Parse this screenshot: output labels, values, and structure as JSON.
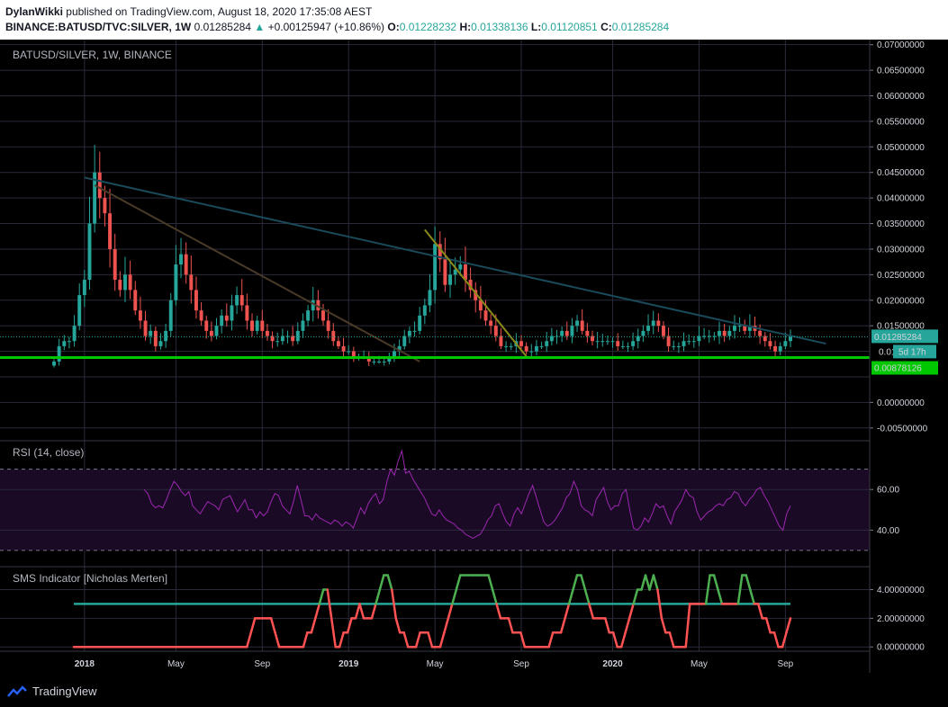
{
  "header": {
    "author": "DylanWikki",
    "published": "published on TradingView.com, August 18, 2020 17:35:08 AEST",
    "symbol": "BINANCE:BATUSD/TVC:SILVER, 1W",
    "last": "0.01285284",
    "change": "+0.00125947 (+10.86%)",
    "o_label": "O:",
    "o": "0.01228232",
    "h_label": "H:",
    "h": "0.01338136",
    "l_label": "L:",
    "l": "0.01120851",
    "c_label": "C:",
    "c": "0.01285284"
  },
  "footer": {
    "brand": "TradingView"
  },
  "colors": {
    "up": "#26a69a",
    "down": "#ef5350",
    "grid": "#2a2a3a",
    "rsi": "#9c27b0",
    "sms_high": "#4caf50",
    "sms_low": "#ff5252",
    "support": "#00c800",
    "trend_long": "#1a4a5a",
    "trend_mid": "#4a3a28",
    "trend_short": "#8a8a1a"
  },
  "chart_data": [
    {
      "type": "candlestick",
      "pane_label": "BATUSD/SILVER, 1W, BINANCE",
      "x_ticks": [
        "2018",
        "May",
        "Sep",
        "2019",
        "May",
        "Sep",
        "2020",
        "May",
        "Sep"
      ],
      "x_tick_weeks": [
        6,
        24,
        41,
        58,
        75,
        92,
        110,
        127,
        144
      ],
      "y_ticks": [
        "0.07000000",
        "0.06500000",
        "0.06000000",
        "0.05500000",
        "0.05000000",
        "0.04500000",
        "0.04000000",
        "0.03500000",
        "0.03000000",
        "0.02500000",
        "0.02000000",
        "0.01500000",
        "0.00000000",
        "-0.00500000"
      ],
      "ylim": [
        -0.0075,
        0.071
      ],
      "last_price_label": "0.01285284",
      "countdown_label": "5d 17h",
      "partial_label": "0.01",
      "support_price": 0.00878126,
      "support_label": "0.00878126",
      "series_closes": [
        0.008,
        0.011,
        0.012,
        0.012,
        0.015,
        0.021,
        0.024,
        0.035,
        0.045,
        0.04,
        0.037,
        0.03,
        0.024,
        0.022,
        0.025,
        0.022,
        0.018,
        0.016,
        0.013,
        0.014,
        0.011,
        0.012,
        0.014,
        0.02,
        0.027,
        0.029,
        0.025,
        0.022,
        0.018,
        0.016,
        0.014,
        0.013,
        0.015,
        0.017,
        0.016,
        0.019,
        0.021,
        0.019,
        0.016,
        0.014,
        0.016,
        0.014,
        0.013,
        0.012,
        0.012,
        0.013,
        0.013,
        0.012,
        0.014,
        0.016,
        0.018,
        0.02,
        0.018,
        0.016,
        0.014,
        0.012,
        0.011,
        0.01,
        0.01,
        0.009,
        0.009,
        0.009,
        0.008,
        0.008,
        0.008,
        0.008,
        0.009,
        0.01,
        0.011,
        0.013,
        0.014,
        0.014,
        0.017,
        0.019,
        0.022,
        0.031,
        0.028,
        0.023,
        0.025,
        0.026,
        0.027,
        0.024,
        0.022,
        0.02,
        0.018,
        0.016,
        0.015,
        0.013,
        0.011,
        0.011,
        0.011,
        0.012,
        0.011,
        0.01,
        0.01,
        0.011,
        0.011,
        0.012,
        0.013,
        0.013,
        0.014,
        0.013,
        0.015,
        0.016,
        0.014,
        0.013,
        0.012,
        0.012,
        0.012,
        0.012,
        0.012,
        0.011,
        0.011,
        0.011,
        0.012,
        0.013,
        0.014,
        0.015,
        0.016,
        0.015,
        0.013,
        0.011,
        0.011,
        0.011,
        0.012,
        0.012,
        0.012,
        0.013,
        0.013,
        0.013,
        0.013,
        0.014,
        0.013,
        0.014,
        0.015,
        0.015,
        0.014,
        0.015,
        0.014,
        0.013,
        0.012,
        0.011,
        0.01,
        0.011,
        0.012,
        0.01285
      ],
      "trendlines": [
        {
          "w0": 6,
          "p0": 0.044,
          "w1": 152,
          "p1": 0.0115
        },
        {
          "w0": 8,
          "p0": 0.0425,
          "w1": 72,
          "p1": 0.008
        },
        {
          "w0": 73,
          "p0": 0.0338,
          "w1": 93,
          "p1": 0.009
        }
      ]
    },
    {
      "type": "line",
      "pane_label": "RSI (14, close)",
      "y_ticks": [
        "60.00",
        "40.00"
      ],
      "ylim": [
        22,
        84
      ],
      "band": [
        30,
        70
      ],
      "values": [
        50,
        50,
        50,
        50,
        50,
        50,
        50,
        50,
        50,
        50,
        50,
        50,
        50,
        50,
        50,
        50,
        50,
        50,
        50,
        50,
        50,
        50,
        50,
        50,
        60,
        58,
        53,
        51,
        52,
        51,
        55,
        60,
        64,
        62,
        59,
        57,
        59,
        52,
        50,
        48,
        51,
        54,
        53,
        52,
        50,
        55,
        56,
        57,
        53,
        49,
        52,
        55,
        50,
        50,
        46,
        49,
        47,
        49,
        54,
        58,
        57,
        52,
        50,
        48,
        54,
        62,
        55,
        47,
        47,
        45,
        48,
        46,
        45,
        44,
        43,
        45,
        44,
        42,
        44,
        43,
        41,
        46,
        51,
        48,
        53,
        56,
        58,
        53,
        55,
        64,
        70,
        67,
        74,
        79,
        68,
        69,
        65,
        62,
        59,
        56,
        52,
        48,
        47,
        50,
        47,
        45,
        44,
        43,
        41,
        40,
        38,
        37,
        36,
        37,
        38,
        41,
        45,
        47,
        52,
        53,
        48,
        44,
        42,
        48,
        51,
        48,
        53,
        58,
        62,
        56,
        50,
        44,
        42,
        43,
        45,
        48,
        51,
        56,
        58,
        64,
        60,
        52,
        50,
        49,
        47,
        55,
        58,
        61,
        54,
        50,
        52,
        52,
        58,
        60,
        50,
        41,
        40,
        42,
        46,
        44,
        48,
        53,
        51,
        52,
        47,
        43,
        49,
        52,
        55,
        60,
        57,
        56,
        49,
        45,
        47,
        49,
        50,
        52,
        53,
        52,
        55,
        56,
        59,
        58,
        54,
        52,
        55,
        57,
        60,
        61,
        57,
        54,
        50,
        46,
        42,
        40,
        48,
        52
      ]
    },
    {
      "type": "step",
      "pane_label": "SMS Indicator [Nicholas Merten]",
      "y_ticks": [
        "4.00000000",
        "2.00000000",
        "0.00000000"
      ],
      "ylim": [
        -0.3,
        5.6
      ],
      "threshold": 3,
      "values": [
        0,
        0,
        0,
        0,
        0,
        0,
        0,
        0,
        0,
        0,
        0,
        0,
        0,
        0,
        0,
        0,
        0,
        0,
        0,
        0,
        0,
        0,
        0,
        0,
        0,
        0,
        0,
        0,
        0,
        0,
        0,
        0,
        0,
        0,
        0,
        0,
        0,
        0,
        0,
        0,
        0,
        0,
        0,
        0,
        1,
        2,
        2,
        2,
        2,
        2,
        1,
        0,
        0,
        0,
        0,
        0,
        0,
        0,
        1,
        1,
        2,
        3,
        4,
        4,
        2,
        0,
        0,
        1,
        1,
        2,
        2,
        3,
        2,
        2,
        2,
        3,
        4,
        5,
        5,
        4,
        2,
        1,
        1,
        0,
        0,
        0,
        1,
        1,
        1,
        0,
        0,
        0,
        1,
        2,
        3,
        4,
        5,
        5,
        5,
        5,
        5,
        5,
        5,
        5,
        4,
        3,
        2,
        2,
        2,
        1,
        1,
        1,
        0,
        0,
        0,
        0,
        0,
        0,
        0,
        1,
        1,
        1,
        2,
        3,
        4,
        5,
        5,
        4,
        3,
        2,
        2,
        2,
        2,
        1,
        1,
        0,
        0,
        1,
        2,
        3,
        4,
        4,
        5,
        4,
        5,
        4,
        2,
        1,
        1,
        0,
        0,
        0,
        0,
        3,
        3,
        3,
        3,
        3,
        5,
        5,
        4,
        3,
        3,
        3,
        3,
        3,
        5,
        5,
        4,
        3,
        3,
        2,
        2,
        1,
        1,
        0,
        0,
        1,
        2
      ]
    }
  ]
}
